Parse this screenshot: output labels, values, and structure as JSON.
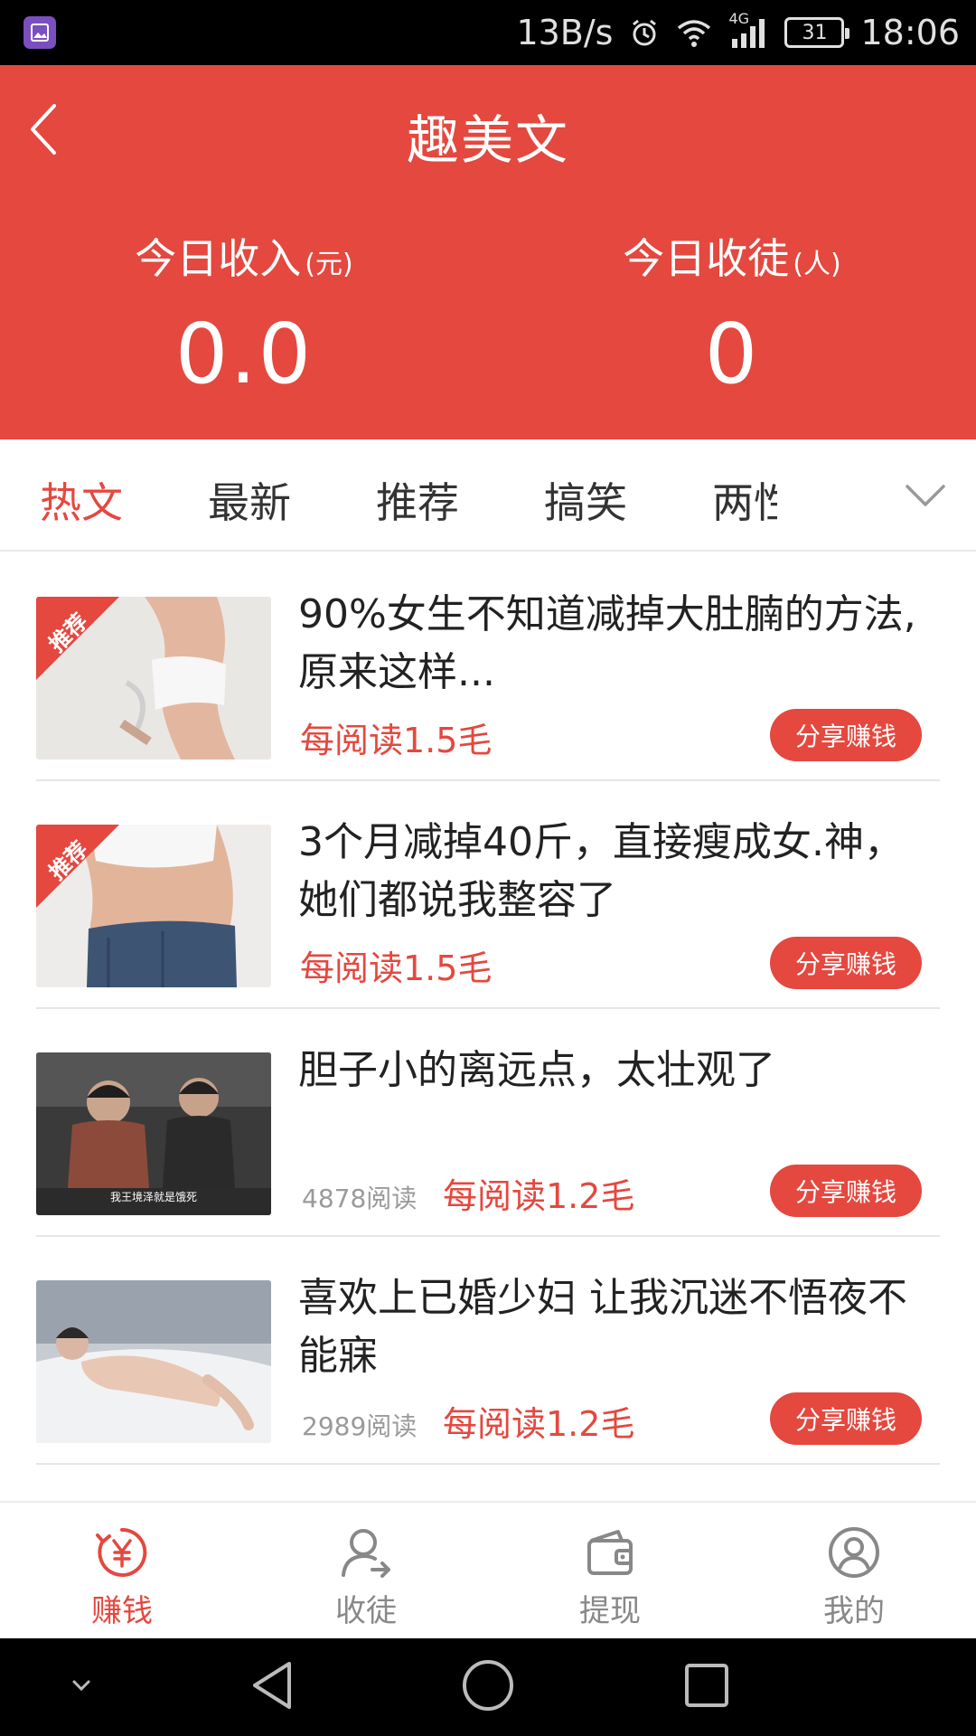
{
  "status_bar": {
    "speed": "13B/s",
    "network": "4G",
    "battery": "31",
    "time": "18:06"
  },
  "header": {
    "title": "趣美文",
    "income_label": "今日收入",
    "income_unit": "(元)",
    "income_value": "0.0",
    "apprentice_label": "今日收徒",
    "apprentice_unit": "(人)",
    "apprentice_value": "0"
  },
  "tabs": [
    {
      "label": "热文",
      "active": true
    },
    {
      "label": "最新",
      "active": false
    },
    {
      "label": "推荐",
      "active": false
    },
    {
      "label": "搞笑",
      "active": false
    },
    {
      "label": "两性",
      "active": false
    }
  ],
  "articles": [
    {
      "title": "90%女生不知道减掉大肚腩的方法,原来这样...",
      "reads": "",
      "reward": "每阅读1.5毛",
      "share": "分享赚钱",
      "badge": "推荐"
    },
    {
      "title": "3个月减掉40斤，直接瘦成女.神，她们都说我整容了",
      "reads": "",
      "reward": "每阅读1.5毛",
      "share": "分享赚钱",
      "badge": "推荐"
    },
    {
      "title": "胆子小的离远点，太壮观了",
      "reads": "4878阅读",
      "reward": "每阅读1.2毛",
      "share": "分享赚钱",
      "badge": "",
      "caption": "我王境泽就是饿死"
    },
    {
      "title": "喜欢上已婚少妇 让我沉迷不悟夜不能寐",
      "reads": "2989阅读",
      "reward": "每阅读1.2毛",
      "share": "分享赚钱",
      "badge": ""
    }
  ],
  "bottom_nav": [
    {
      "label": "赚钱",
      "icon": "yuan-refresh-icon",
      "active": true
    },
    {
      "label": "收徒",
      "icon": "user-add-icon",
      "active": false
    },
    {
      "label": "提现",
      "icon": "wallet-icon",
      "active": false
    },
    {
      "label": "我的",
      "icon": "profile-icon",
      "active": false
    }
  ],
  "colors": {
    "accent": "#e4483f",
    "text": "#222222",
    "muted": "#9a9a9a"
  }
}
